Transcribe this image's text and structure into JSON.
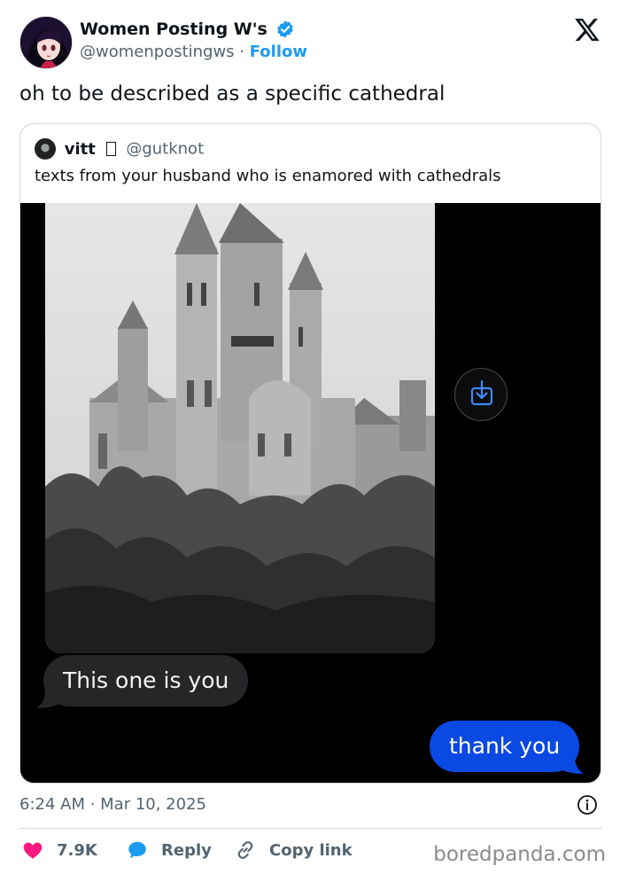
{
  "author": {
    "name": "Women Posting W's",
    "handle": "@womenpostingws",
    "separator": " · ",
    "follow_label": "Follow"
  },
  "tweet": {
    "text": "oh to be described as a specific cathedral",
    "timestamp": "6:24 AM · Mar 10, 2025"
  },
  "quote": {
    "name": "vitt",
    "handle": "@gutknot",
    "text": "texts from your husband who is enamored with cathedrals",
    "messages": {
      "incoming": "This one is you",
      "outgoing": "thank you"
    }
  },
  "actions": {
    "like_count": "7.9K",
    "reply_label": "Reply",
    "copy_label": "Copy link"
  },
  "watermark": "boredpanda.com",
  "colors": {
    "accent": "#1d9bf0",
    "like": "#f91880",
    "imessage_blue": "#0b49e3",
    "imessage_gray": "#262628"
  },
  "icons": [
    "verified-badge-icon",
    "x-logo-icon",
    "download-icon",
    "info-icon",
    "heart-icon",
    "reply-bubble-icon",
    "link-icon"
  ]
}
